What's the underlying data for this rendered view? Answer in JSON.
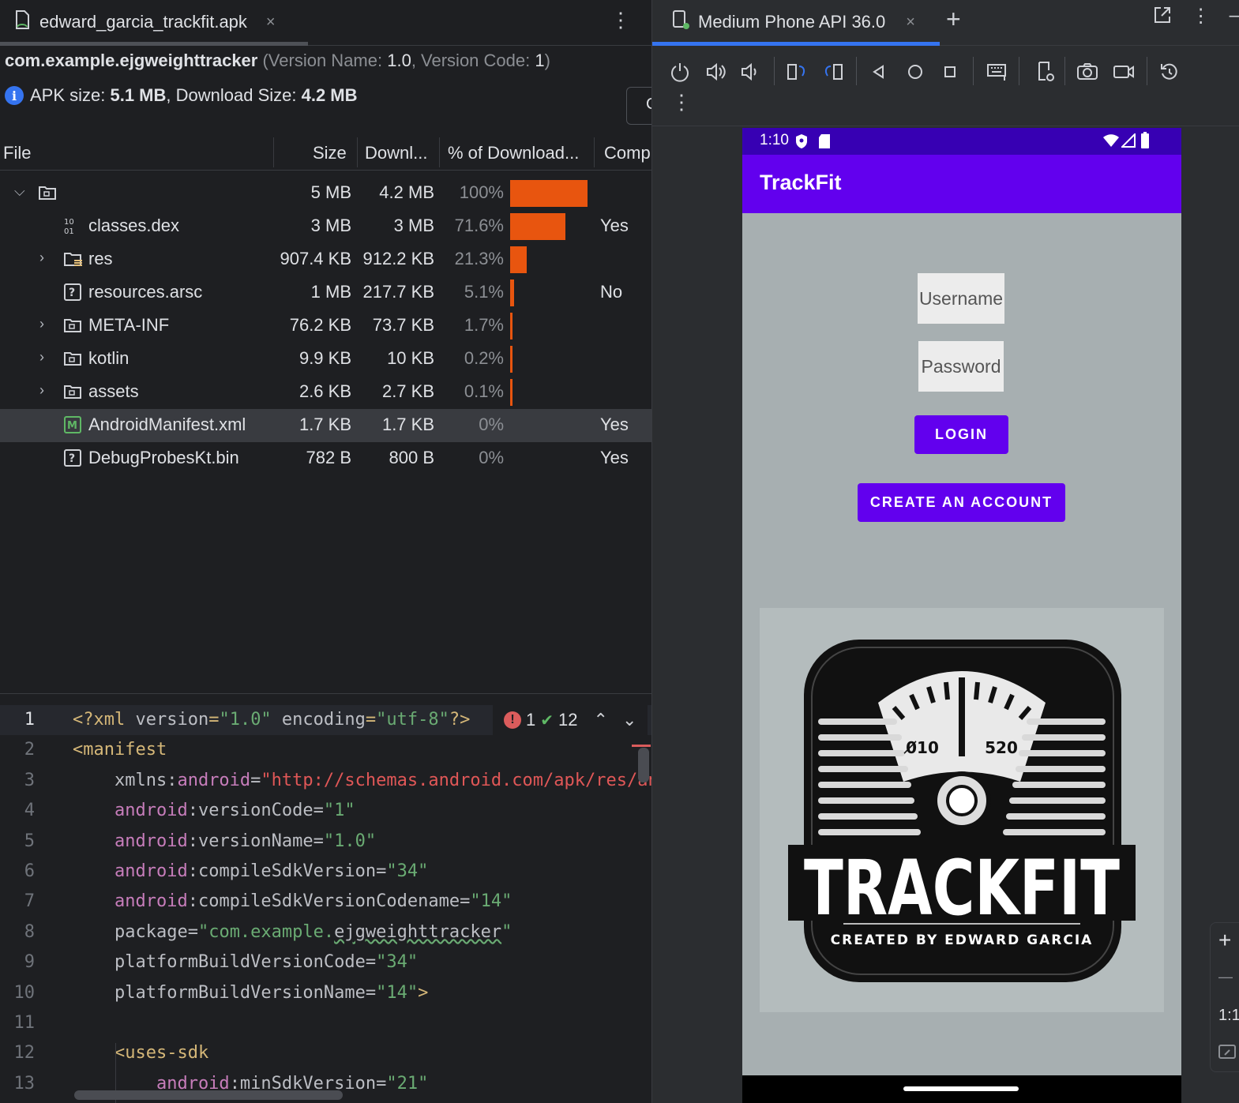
{
  "left_tab": {
    "title": "edward_garcia_trackfit.apk",
    "close": "×",
    "menu": "⋮"
  },
  "apk": {
    "package": "com.example.ejgweighttracker",
    "version_label_open": "(Version Name: ",
    "version_name": "1.0",
    "version_code_label": ", Version Code: ",
    "version_code": "1",
    "version_label_close": ")",
    "apk_size_label": "APK size: ",
    "apk_size": "5.1 MB",
    "download_size_label": ", Download Size: ",
    "download_size": "4.2 MB",
    "compare_button": "C"
  },
  "table": {
    "headers": {
      "file": "File",
      "size": "Size",
      "download": "Downl...",
      "percent": "% of Download...",
      "compressed": "Comp"
    },
    "rows": [
      {
        "name": "",
        "size": "5 MB",
        "download": "4.2 MB",
        "percent": "100%",
        "fraction": 1.0,
        "compressed": "",
        "icon": "folder-icon",
        "expandable": true,
        "expanded": true,
        "indent": 0
      },
      {
        "name": "classes.dex",
        "size": "3 MB",
        "download": "3 MB",
        "percent": "71.6%",
        "fraction": 0.716,
        "compressed": "Yes",
        "icon": "dex-icon",
        "expandable": false,
        "indent": 1
      },
      {
        "name": "res",
        "size": "907.4 KB",
        "download": "912.2 KB",
        "percent": "21.3%",
        "fraction": 0.213,
        "compressed": "",
        "icon": "resource-folder-icon",
        "expandable": true,
        "indent": 1
      },
      {
        "name": "resources.arsc",
        "size": "1 MB",
        "download": "217.7 KB",
        "percent": "5.1%",
        "fraction": 0.051,
        "compressed": "No",
        "icon": "unknown-file-icon",
        "expandable": false,
        "indent": 1
      },
      {
        "name": "META-INF",
        "size": "76.2 KB",
        "download": "73.7 KB",
        "percent": "1.7%",
        "fraction": 0.017,
        "compressed": "",
        "icon": "folder-icon",
        "expandable": true,
        "indent": 1
      },
      {
        "name": "kotlin",
        "size": "9.9 KB",
        "download": "10 KB",
        "percent": "0.2%",
        "fraction": 0.002,
        "compressed": "",
        "icon": "folder-icon",
        "expandable": true,
        "indent": 1
      },
      {
        "name": "assets",
        "size": "2.6 KB",
        "download": "2.7 KB",
        "percent": "0.1%",
        "fraction": 0.001,
        "compressed": "",
        "icon": "folder-icon",
        "expandable": true,
        "indent": 1
      },
      {
        "name": "AndroidManifest.xml",
        "size": "1.7 KB",
        "download": "1.7 KB",
        "percent": "0%",
        "fraction": 0,
        "compressed": "Yes",
        "icon": "manifest-icon",
        "expandable": false,
        "indent": 1,
        "selected": true
      },
      {
        "name": "DebugProbesKt.bin",
        "size": "782 B",
        "download": "800 B",
        "percent": "0%",
        "fraction": 0,
        "compressed": "Yes",
        "icon": "unknown-file-icon",
        "expandable": false,
        "indent": 1
      }
    ]
  },
  "editor": {
    "line_numbers": [
      "1",
      "2",
      "3",
      "4",
      "5",
      "6",
      "7",
      "8",
      "9",
      "10",
      "11",
      "12",
      "13"
    ],
    "lines": [
      [
        [
          "tag",
          "<?xml "
        ],
        [
          "attr",
          "version"
        ],
        [
          "tag",
          "="
        ],
        [
          "str",
          "\"1.0\""
        ],
        [
          "attr",
          " encoding"
        ],
        [
          "tag",
          "="
        ],
        [
          "str",
          "\"utf-8\""
        ],
        [
          "tag",
          "?>"
        ]
      ],
      [
        [
          "tag",
          "<manifest"
        ]
      ],
      [
        [
          "attr",
          "    xmlns:"
        ],
        [
          "ns",
          "android"
        ],
        [
          "attr",
          "="
        ],
        [
          "url",
          "\"http://schemas.android.com/apk/res/android\""
        ]
      ],
      [
        [
          "ns",
          "    android"
        ],
        [
          "attr",
          ":versionCode="
        ],
        [
          "str",
          "\"1\""
        ]
      ],
      [
        [
          "ns",
          "    android"
        ],
        [
          "attr",
          ":versionName="
        ],
        [
          "str",
          "\"1.0\""
        ]
      ],
      [
        [
          "ns",
          "    android"
        ],
        [
          "attr",
          ":compileSdkVersion="
        ],
        [
          "str",
          "\"34\""
        ]
      ],
      [
        [
          "ns",
          "    android"
        ],
        [
          "attr",
          ":compileSdkVersionCodename="
        ],
        [
          "str",
          "\"14\""
        ]
      ],
      [
        [
          "attr",
          "    package="
        ],
        [
          "str",
          "\"com.example."
        ],
        [
          "squig",
          "ejgweighttracker"
        ],
        [
          "str",
          "\""
        ]
      ],
      [
        [
          "attr",
          "    platformBuildVersionCode="
        ],
        [
          "str",
          "\"34\""
        ]
      ],
      [
        [
          "attr",
          "    platformBuildVersionName="
        ],
        [
          "str",
          "\"14\""
        ],
        [
          "tag",
          ">"
        ]
      ],
      [
        [
          "attr",
          ""
        ]
      ],
      [
        [
          "tag",
          "    <uses-sdk"
        ]
      ],
      [
        [
          "ns",
          "        android"
        ],
        [
          "attr",
          ":minSdkVersion="
        ],
        [
          "str",
          "\"21\""
        ]
      ]
    ],
    "inspections": {
      "errors": "1",
      "ok": "12",
      "error_glyph": "!",
      "ok_glyph": "✔",
      "prev": "⌃",
      "next": "⌄"
    }
  },
  "right_tab": {
    "title": "Medium Phone API 36.0",
    "close": "×",
    "add": "+"
  },
  "device_toolbar": {
    "icons": [
      "power-icon",
      "volume-up-icon",
      "volume-down-icon",
      "rotate-left-icon",
      "rotate-right-icon",
      "back-icon",
      "home-icon",
      "overview-icon",
      "keyboard-icon",
      "device-settings-icon",
      "camera-icon",
      "screen-record-icon",
      "reset-icon"
    ]
  },
  "phone": {
    "time": "1:10",
    "app_title": "TrackFit",
    "username_placeholder": "Username",
    "password_placeholder": "Password",
    "login_label": "LOGIN",
    "create_label": "CREATE AN ACCOUNT",
    "logo": {
      "dial_left": "0̸10",
      "dial_right": "520",
      "wordmark": "TRACKFIT",
      "credit": "CREATED BY EDWARD GARCIA"
    }
  },
  "zoom": {
    "plus": "+",
    "minus": "—",
    "ratio": "1:1"
  }
}
